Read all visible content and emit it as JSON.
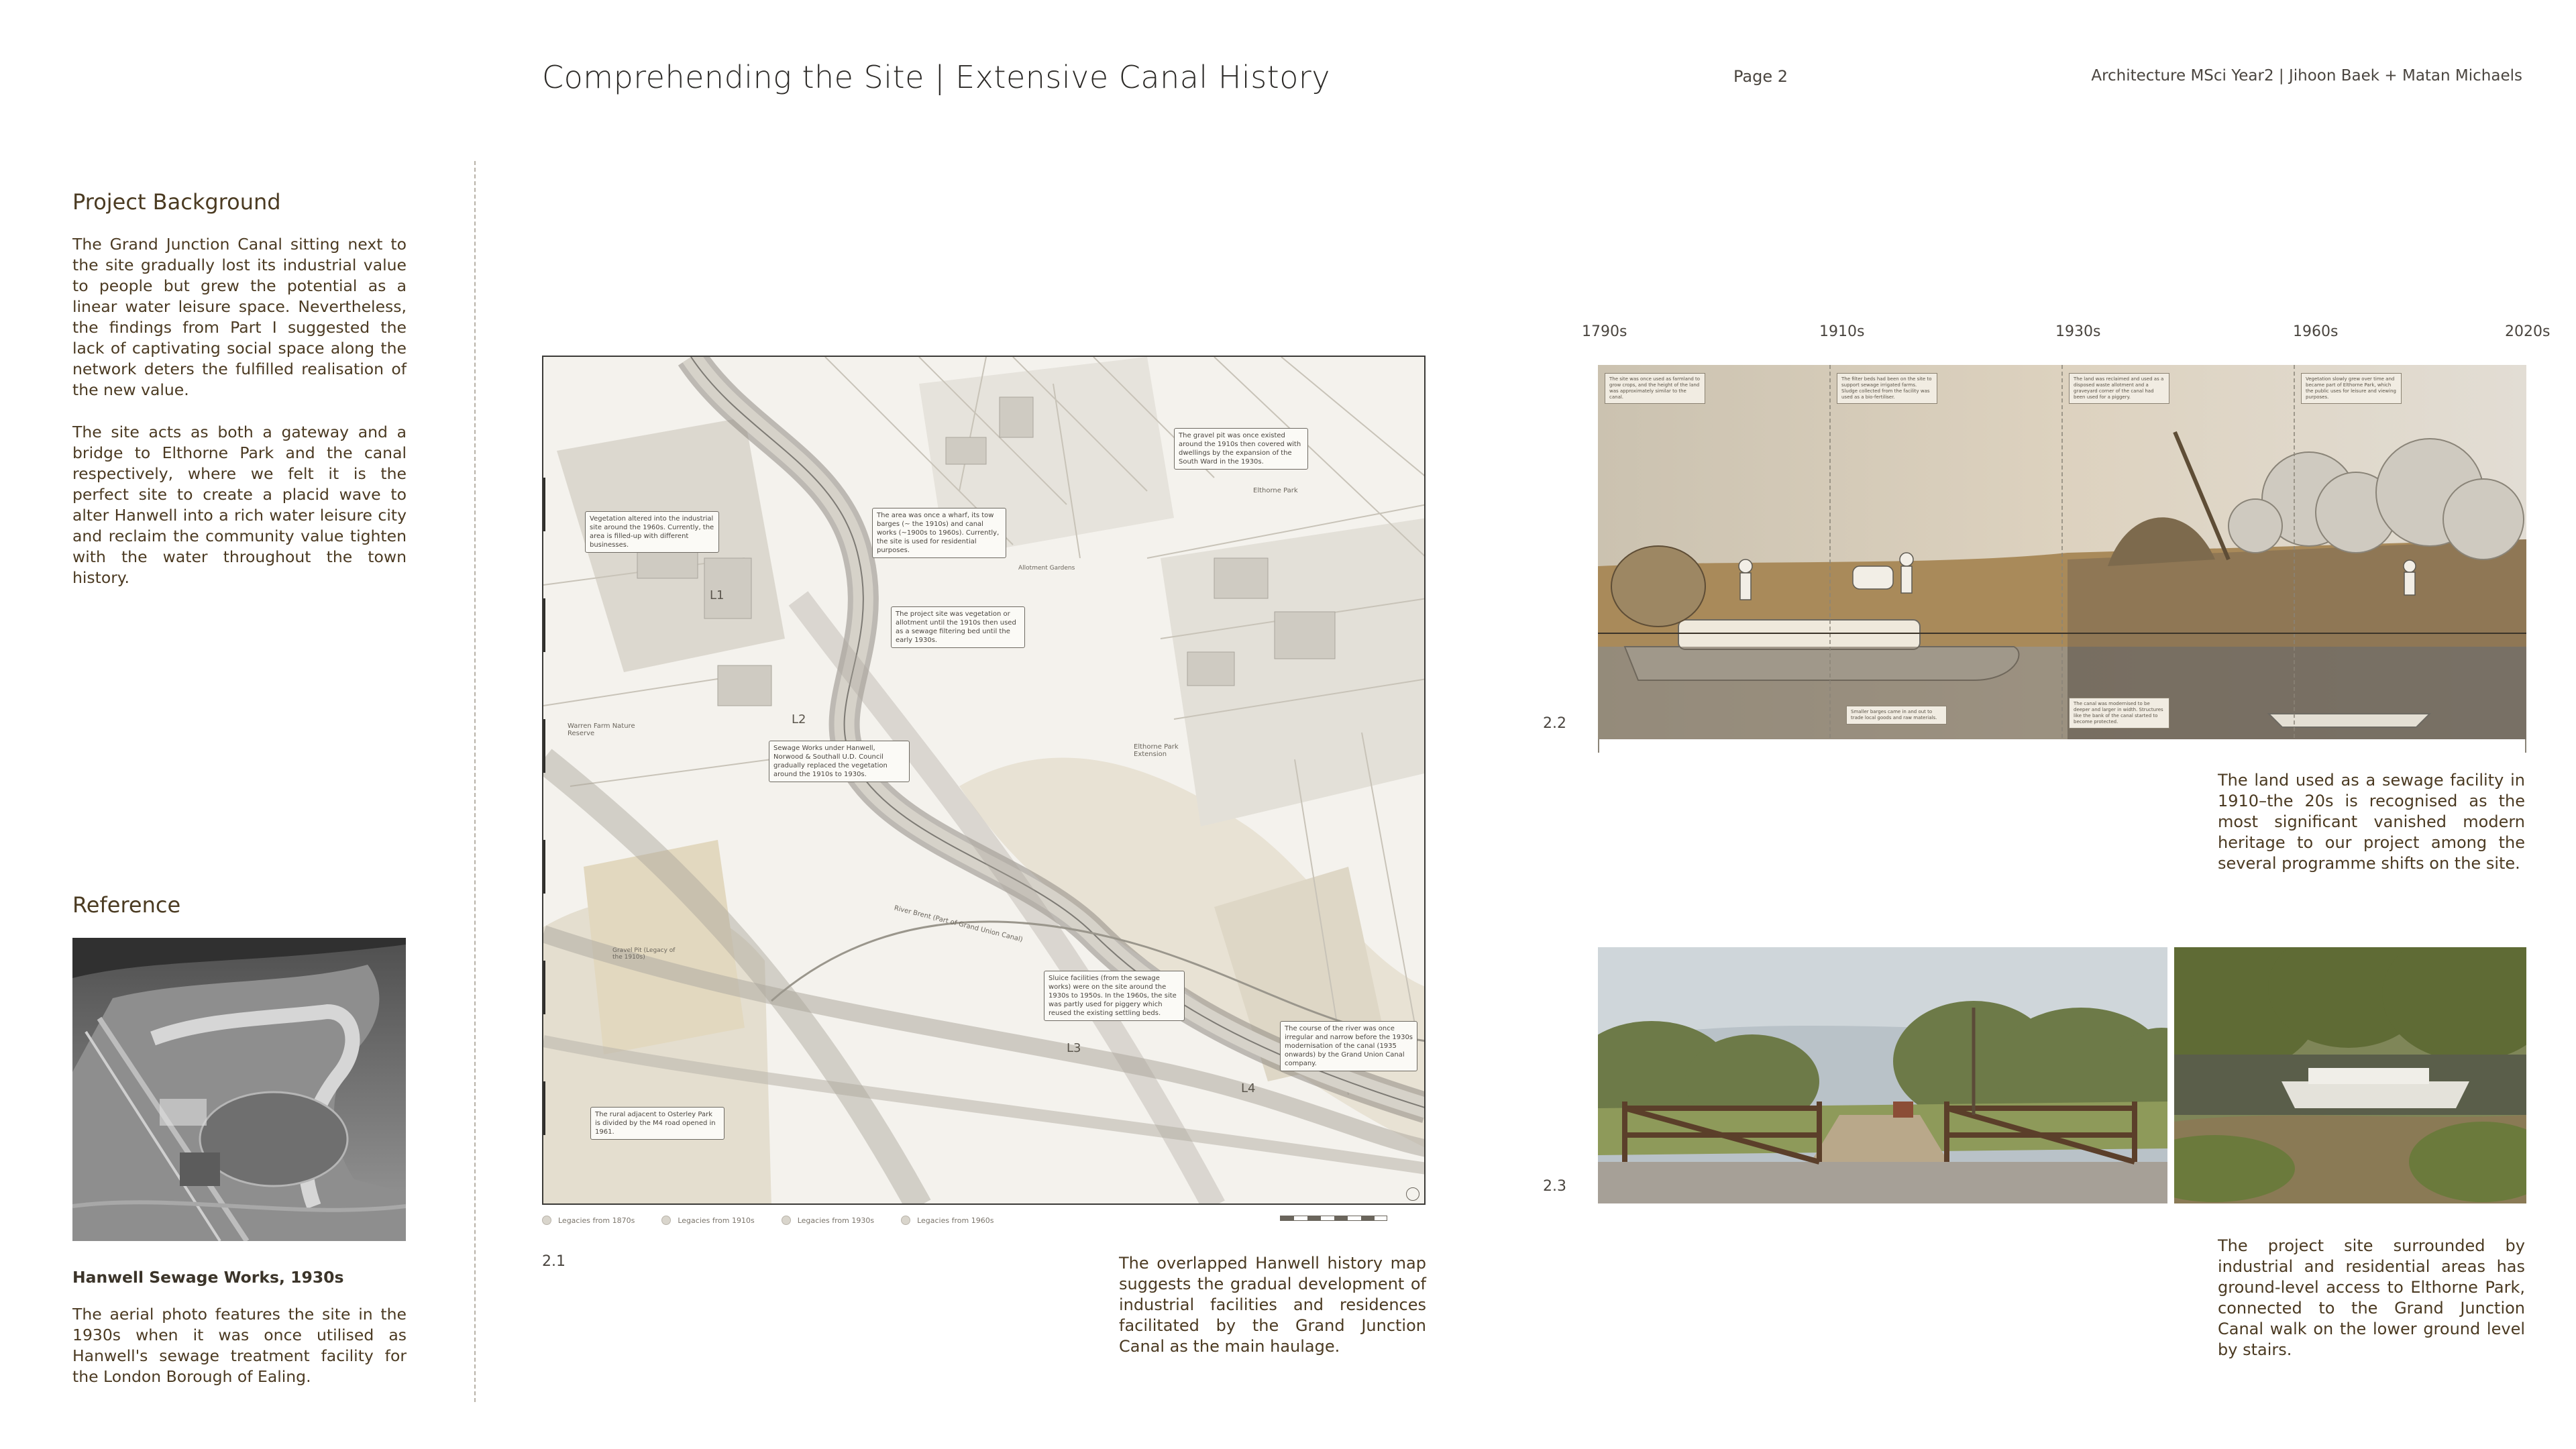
{
  "header": {
    "title": "Comprehending the Site | Extensive Canal History",
    "page": "Page 2",
    "course": "Architecture MSci Year2 | Jihoon Baek + Matan Michaels"
  },
  "background": {
    "heading": "Project Background",
    "para1": "The Grand Junction Canal sitting next to the site gradually lost its industrial value to people but grew the potential as a  linear water leisure space. Nevertheless, the findings from Part I suggested the lack of captivating social space along the network deters the fulfilled realisation of the new value.",
    "para2": "The site acts as both a gateway and a bridge to Elthorne Park and the canal respectively, where we felt it is the perfect site to create a placid wave to alter Hanwell into a rich water leisure city and reclaim the community value tighten with the water throughout the town history."
  },
  "reference": {
    "heading": "Reference",
    "photo_title": "Hanwell Sewage Works, 1930s",
    "photo_caption": "The aerial photo features the site in the 1930s when it was once utilised as Hanwell's sewage treatment facility for the London Borough of Ealing."
  },
  "map": {
    "figure_number": "2.1",
    "notes": [
      "Vegetation altered into the industrial site around the 1960s. Currently, the area is filled-up with different businesses.",
      "The area was once  a wharf, its tow barges (~ the 1910s) and canal works (~1900s to 1960s). Currently, the site is used for residential purposes.",
      "The gravel pit was once existed around the 1910s then covered with dwellings by the expansion of the South Ward in the 1930s.",
      "The project site was vegetation or allotment until the 1910s then used as a sewage filtering bed until the early 1930s.",
      "Sewage Works under Hanwell, Norwood & Southall U.D. Council gradually replaced the vegetation around the 1910s to 1930s.",
      "Sluice facilities (from the sewage works) were on the site around the 1930s to 1950s. In the 1960s, the site was partly used for piggery which reused the existing settling beds.",
      "The course of the river was once irregular and narrow before the 1930s modernisation of the canal (1935 onwards) by the Grand Union Canal company.",
      "The rural adjacent to Osterley Park is divided by the M4 road opened in 1961."
    ],
    "place_labels": [
      "Elthorne Park",
      "Warren Farm Nature Reserve",
      "Elthorne Park Extension",
      "River Brent (Part of Grand Union Canal)",
      "Gravel Pit (Legacy of the 1910s)",
      "Allotment Gardens"
    ],
    "markers": [
      "L1",
      "L2",
      "L3",
      "L4"
    ],
    "legend": [
      "Legacies from 1870s",
      "Legacies from 1910s",
      "Legacies from 1930s",
      "Legacies from 1960s"
    ],
    "caption": "The overlapped Hanwell history map suggests the gradual development of industrial facilities and residences facilitated by the Grand Junction Canal as the main haulage."
  },
  "timeline": {
    "figure_number": "2.2",
    "years": [
      "1790s",
      "1910s",
      "1930s",
      "1960s",
      "2020s"
    ],
    "notes": [
      "The site was once used as farmland to grow crops, and the height of the land was approximately similar to the canal.",
      "The filter beds had been on the site to support sewage irrigated farms. Sludge collected from the facility was used as a bio-fertiliser.",
      "The land was reclaimed and used as a disposed waste allotment and a graveyard corner of the canal had been used for a piggery.",
      "Vegetation slowly grew over time and became part of Elthorne Park, which the public uses for leisure and viewing purposes.",
      "Smaller barges came in and out to trade local goods and raw materials.",
      "The canal was modernised to be deeper and larger in width. Structures like the bank of the canal started to become protected."
    ],
    "caption": "The land used as a sewage facility in 1910–the 20s is recognised as the most significant vanished modern heritage to our project among the several programme shifts on the site."
  },
  "photos": {
    "figure_number": "2.3",
    "caption": "The project site surrounded by industrial and residential areas has ground-level access to Elthorne Park, connected to the Grand Junction Canal walk on the lower ground level by stairs."
  }
}
